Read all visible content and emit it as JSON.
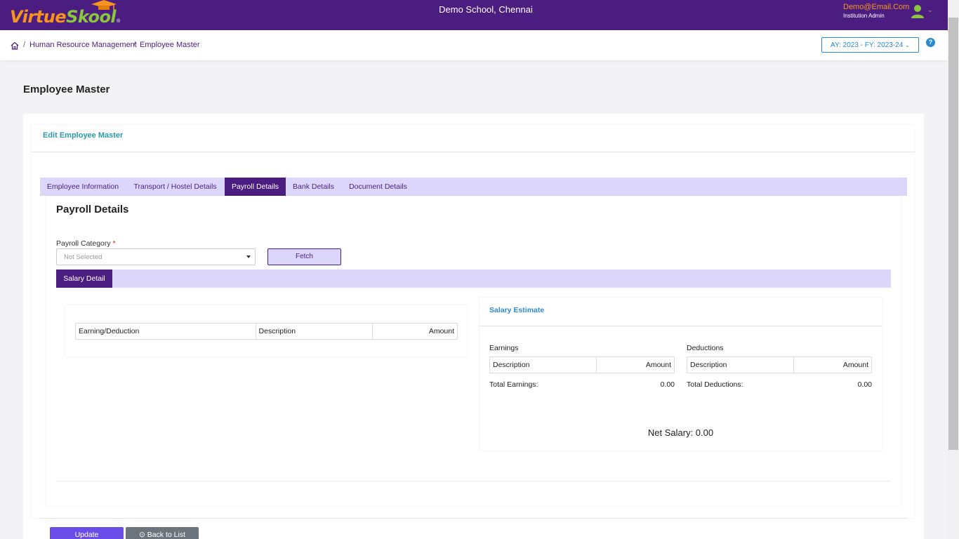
{
  "header": {
    "logo_part1": "Virtue",
    "logo_part2": "Skool",
    "logo_reg": "®",
    "school_name": "Demo School, Chennai",
    "user_email": "Demo@Email.Com",
    "user_role": "Institution Admin"
  },
  "breadcrumb": {
    "item1": "Human Resource Management",
    "item2": "Employee Master",
    "separator": "/"
  },
  "year_selector": "AY: 2023 - FY: 2023-24",
  "page_title": "Employee Master",
  "card_title": "Edit Employee Master",
  "tabs": [
    {
      "label": "Employee Information"
    },
    {
      "label": "Transport / Hostel Details"
    },
    {
      "label": "Payroll Details"
    },
    {
      "label": "Bank Details"
    },
    {
      "label": "Document Details"
    }
  ],
  "payroll": {
    "section_title": "Payroll Details",
    "category_label": "Payroll Category",
    "required_mark": "*",
    "category_value": "Not Selected",
    "fetch_label": "Fetch",
    "subtab_label": "Salary Detail",
    "detail_headers": {
      "col1": "Earning/Deduction",
      "col2": "Description",
      "col3": "Amount"
    },
    "estimate": {
      "title": "Salary Estimate",
      "earnings_label": "Earnings",
      "deductions_label": "Deductions",
      "desc_header": "Description",
      "amount_header": "Amount",
      "total_earnings_label": "Total Earnings:",
      "total_earnings_value": "0.00",
      "total_deductions_label": "Total Deductions:",
      "total_deductions_value": "0.00",
      "net_salary": "Net Salary: 0.00"
    }
  },
  "actions": {
    "update_label": "Update",
    "back_label": "Back to List"
  },
  "colors": {
    "brand_purple": "#4c1d80",
    "accent_orange": "#f7941d",
    "accent_green": "#8cc63f",
    "link_blue": "#2b8ad0"
  }
}
